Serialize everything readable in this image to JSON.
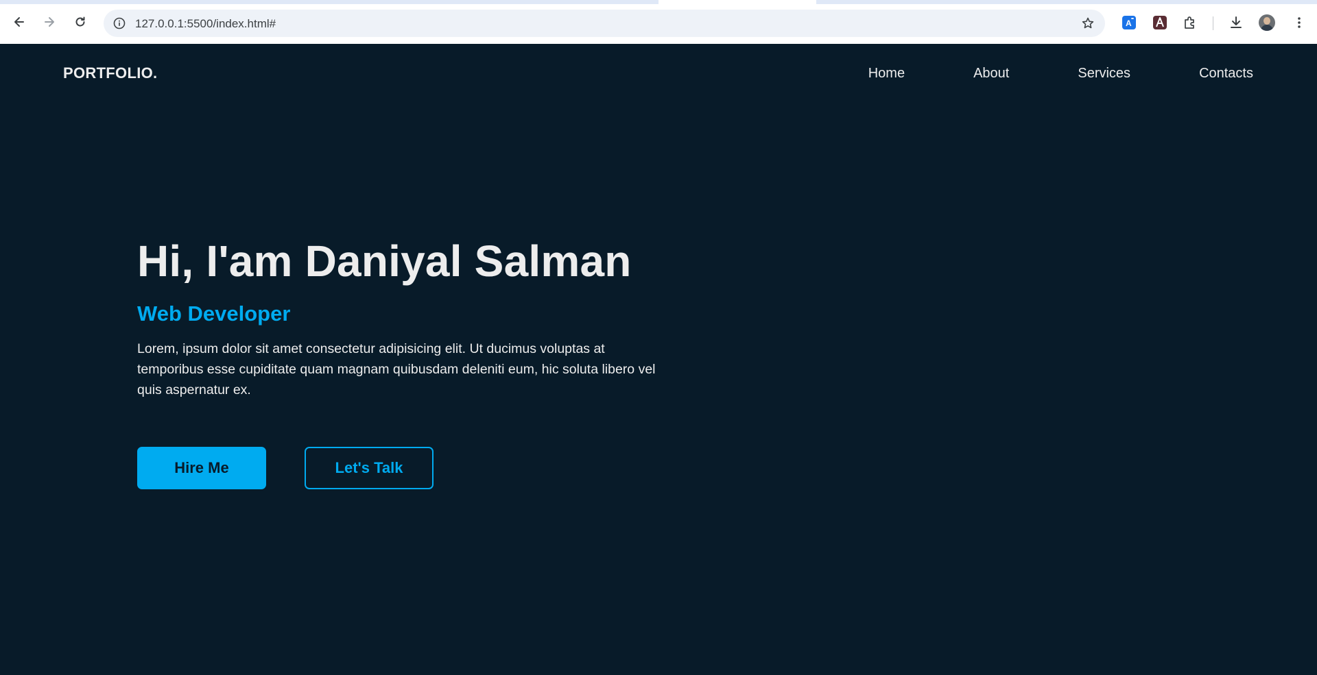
{
  "browser": {
    "url": "127.0.0.1:5500/index.html#",
    "icons": {
      "back": "back-arrow-icon",
      "forward": "forward-arrow-icon",
      "reload": "reload-icon",
      "site_info": "info-icon",
      "bookmark": "star-icon",
      "translate_extension": "translate-extension-icon",
      "pdf_extension": "pdf-extension-icon",
      "extensions": "puzzle-icon",
      "downloads": "download-icon",
      "profile": "avatar",
      "menu": "kebab-menu-icon"
    }
  },
  "site": {
    "logo": "PORTFOLIO.",
    "nav": [
      {
        "label": "Home"
      },
      {
        "label": "About"
      },
      {
        "label": "Services"
      },
      {
        "label": "Contacts"
      }
    ],
    "hero": {
      "title": "Hi, I'am Daniyal Salman",
      "subtitle": "Web Developer",
      "description": "Lorem, ipsum dolor sit amet consectetur adipisicing elit. Ut ducimus voluptas at temporibus esse cupiditate quam magnam quibusdam deleniti eum, hic soluta libero vel quis aspernatur ex.",
      "primary_button": "Hire Me",
      "secondary_button": "Let's Talk"
    }
  },
  "colors": {
    "background": "#081b29",
    "text": "#ededed",
    "accent": "#00abf0"
  }
}
